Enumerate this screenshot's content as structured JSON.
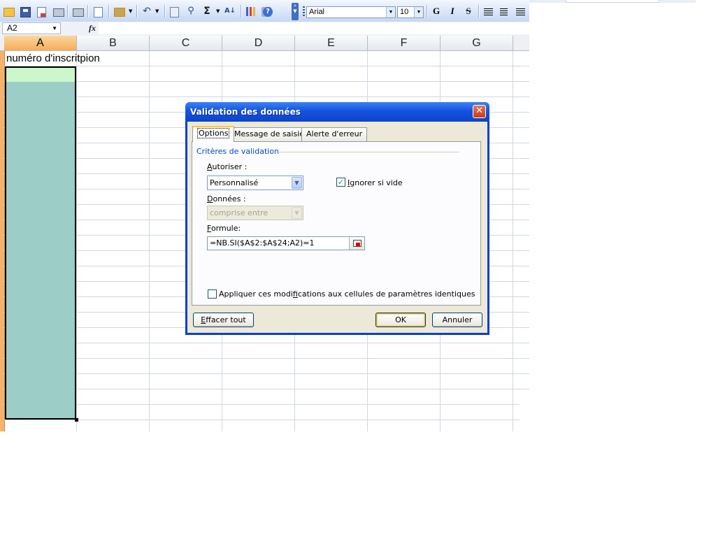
{
  "toolbar": {
    "font_name": "Arial",
    "font_size": "10",
    "sum_symbol": "Σ",
    "sort_symbol": "A↓",
    "help_symbol": "?",
    "bold_label": "G",
    "italic_label": "I",
    "strike_label": "S"
  },
  "formula_bar": {
    "name_box": "A2",
    "fx_label": "fx",
    "formula": ""
  },
  "sheet": {
    "columns": [
      "A",
      "B",
      "C",
      "D",
      "E",
      "F",
      "G"
    ],
    "cell_a1": "numéro d'inscritpion",
    "colors": {
      "selection": "#9ccdc6",
      "active_cell": "#ccf6cc",
      "active_header": "#f5ad5b"
    }
  },
  "dialog": {
    "title": "Validation des données",
    "close_symbol": "✕",
    "tabs": [
      "Options",
      "Message de saisie",
      "Alerte d'erreur"
    ],
    "group_label": "Critères de validation",
    "allow_label_pre": "A",
    "allow_label_rest": "utoriser :",
    "allow_value": "Personnalisé",
    "ignore_blank_pre": "I",
    "ignore_blank_rest": "gnorer si vide",
    "ignore_blank_checked": true,
    "check_mark": "✓",
    "data_label_pre": "D",
    "data_label_rest": "onnées :",
    "data_value": "comprise entre",
    "formula_label_pre": "F",
    "formula_label_rest": "ormule:",
    "formula_value": "=NB.SI($A$2:$A$24;A2)=1",
    "apply_label_pre": "Appliquer ces modi",
    "apply_label_u": "f",
    "apply_label_rest": "ications aux cellules de paramètres identiques",
    "apply_checked": false,
    "clear_button_pre": "E",
    "clear_button_rest": "ffacer tout",
    "ok_button": "OK",
    "cancel_button": "Annuler"
  }
}
